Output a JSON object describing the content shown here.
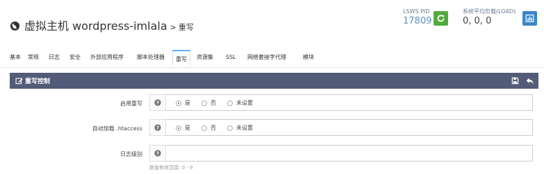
{
  "header": {
    "title_main": "虚拟主机 wordpress-imlala",
    "title_sep": ">",
    "title_sub": "重写",
    "pid_label": "LSWS PID",
    "pid_value": "17809",
    "load_label": "系统平均负载(LOAD)",
    "load_value": "0, 0, 0",
    "restart_icon": "refresh-icon",
    "chart_icon": "bar-chart-icon"
  },
  "tabs": [
    {
      "label": "基本"
    },
    {
      "label": "常规"
    },
    {
      "label": "日志"
    },
    {
      "label": "安全"
    },
    {
      "label": "外部应用程序"
    },
    {
      "label": "脚本处理器"
    },
    {
      "label": "重写",
      "active": true
    },
    {
      "label": "资源集"
    },
    {
      "label": "SSL"
    },
    {
      "label": "网络套接字代理"
    },
    {
      "label": "模块"
    }
  ],
  "panel": {
    "title": "重写控制",
    "title_icon": "edit-icon",
    "save_icon": "save-icon",
    "back_icon": "back-arrow-icon",
    "header_color": "#525c78"
  },
  "fields": {
    "rewrite_enable": {
      "label": "启用重写",
      "options": [
        "是",
        "否",
        "未设置"
      ],
      "selected": "是"
    },
    "autoload_htaccess": {
      "label": "自动加载 .htaccess",
      "options": [
        "是",
        "否",
        "未设置"
      ],
      "selected": "是"
    },
    "log_level": {
      "label": "日志级别",
      "value": "",
      "hint": "数值有效范围: 0 - 9"
    }
  },
  "colors": {
    "restart_button": "#53a93f",
    "chart_button": "#3a86c9",
    "accent": "#5db2ff"
  }
}
